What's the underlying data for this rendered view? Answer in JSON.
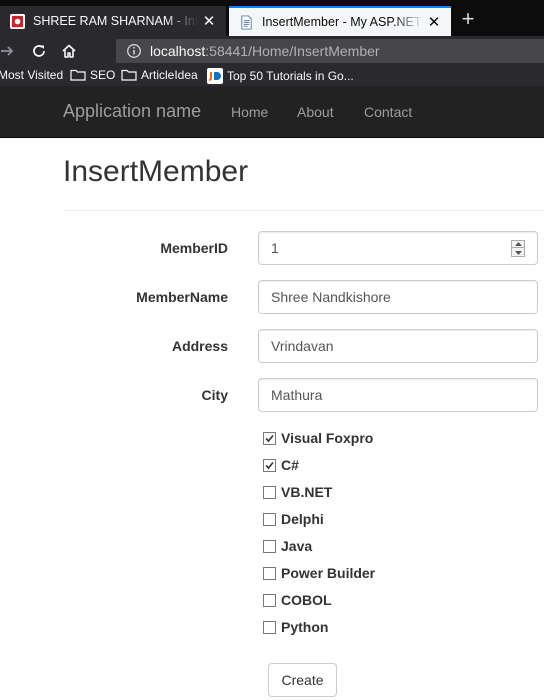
{
  "browser": {
    "tabs": [
      {
        "title": "SHREE RAM SHARNAM - Internet",
        "active": false
      },
      {
        "title": "InsertMember - My ASP.NET Application",
        "active": true
      }
    ],
    "url_host": "localhost",
    "url_rest": ":58441/Home/InsertMember",
    "bookmarks": [
      {
        "label": "Most Visited",
        "icon": "gear-icon"
      },
      {
        "label": "SEO",
        "icon": "folder-icon"
      },
      {
        "label": "ArticleIdea",
        "icon": "folder-icon"
      },
      {
        "label": "Top 50 Tutorials in Go...",
        "icon": "jd-favicon"
      }
    ]
  },
  "app": {
    "brand": "Application name",
    "nav": [
      "Home",
      "About",
      "Contact"
    ]
  },
  "page": {
    "title": "InsertMember",
    "fields": [
      {
        "label": "MemberID",
        "value": "1"
      },
      {
        "label": "MemberName",
        "value": "Shree Nandkishore"
      },
      {
        "label": "Address",
        "value": "Vrindavan"
      },
      {
        "label": "City",
        "value": "Mathura"
      }
    ],
    "languages": [
      {
        "label": "Visual Foxpro",
        "checked": true
      },
      {
        "label": "C#",
        "checked": true
      },
      {
        "label": "VB.NET",
        "checked": false
      },
      {
        "label": "Delphi",
        "checked": false
      },
      {
        "label": "Java",
        "checked": false
      },
      {
        "label": "Power Builder",
        "checked": false
      },
      {
        "label": "COBOL",
        "checked": false
      },
      {
        "label": "Python",
        "checked": false
      }
    ],
    "submit_label": "Create"
  },
  "colors": {
    "tab_accent": "#0a84ff",
    "app_navbar": "#222222",
    "nav_text": "#9d9d9d"
  }
}
